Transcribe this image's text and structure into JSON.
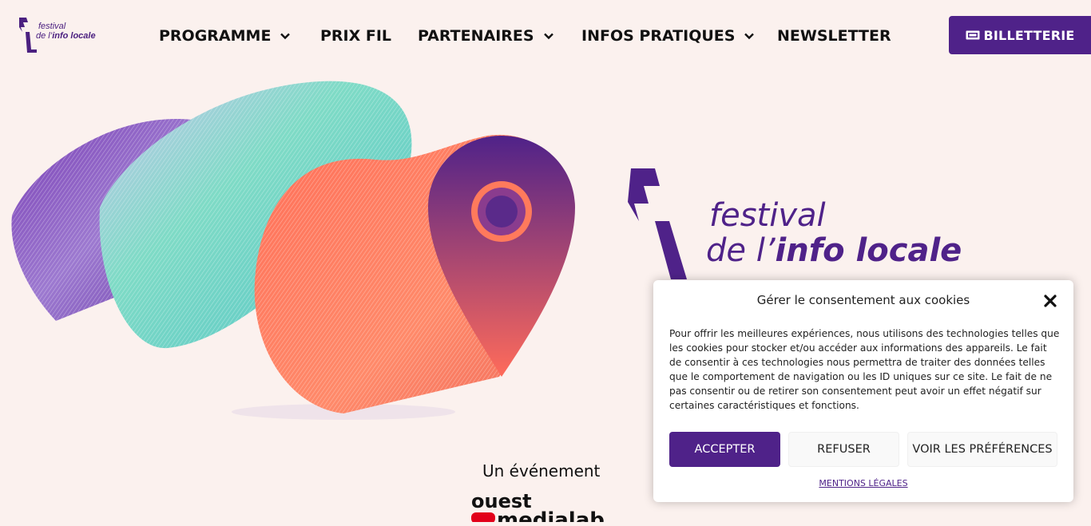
{
  "header": {
    "logo_line1": "festival",
    "logo_line2_prefix": "de l’",
    "logo_line2_bold": "info locale",
    "nav": [
      {
        "label": "PROGRAMME",
        "dropdown": true
      },
      {
        "label": "PRIX FIL",
        "dropdown": false
      },
      {
        "label": "PARTENAIRES",
        "dropdown": true
      },
      {
        "label": "INFOS PRATIQUES",
        "dropdown": true
      },
      {
        "label": "NEWSLETTER",
        "dropdown": false
      }
    ],
    "ticket_label": "BILLETTERIE"
  },
  "hero": {
    "logo_line1": "festival",
    "logo_line2_prefix": "de l’",
    "logo_line2_bold": "info locale",
    "event_label": "Un événement",
    "partner_logo_top": "ouest",
    "partner_logo_bottom": "medialab"
  },
  "cookie": {
    "title": "Gérer le consentement aux cookies",
    "description": "Pour offrir les meilleures expériences, nous utilisons des technologies telles que les cookies pour stocker et/ou accéder aux informations des appareils. Le fait de consentir à ces technologies nous permettra de traiter des données telles que le comportement de navigation ou les ID uniques sur ce site. Le fait de ne pas consentir ou de retirer son consentement peut avoir un effet négatif sur certaines caractéristiques et fonctions.",
    "accept": "ACCEPTER",
    "refuse": "REFUSER",
    "preferences": "VOIR LES PRÉFÉRENCES",
    "legal": "MENTIONS LÉGALES"
  },
  "colors": {
    "brand_purple": "#4f2289",
    "background": "#fbf1ee",
    "accent_coral": "#ff7a5c",
    "accent_teal": "#6fd0c6"
  }
}
